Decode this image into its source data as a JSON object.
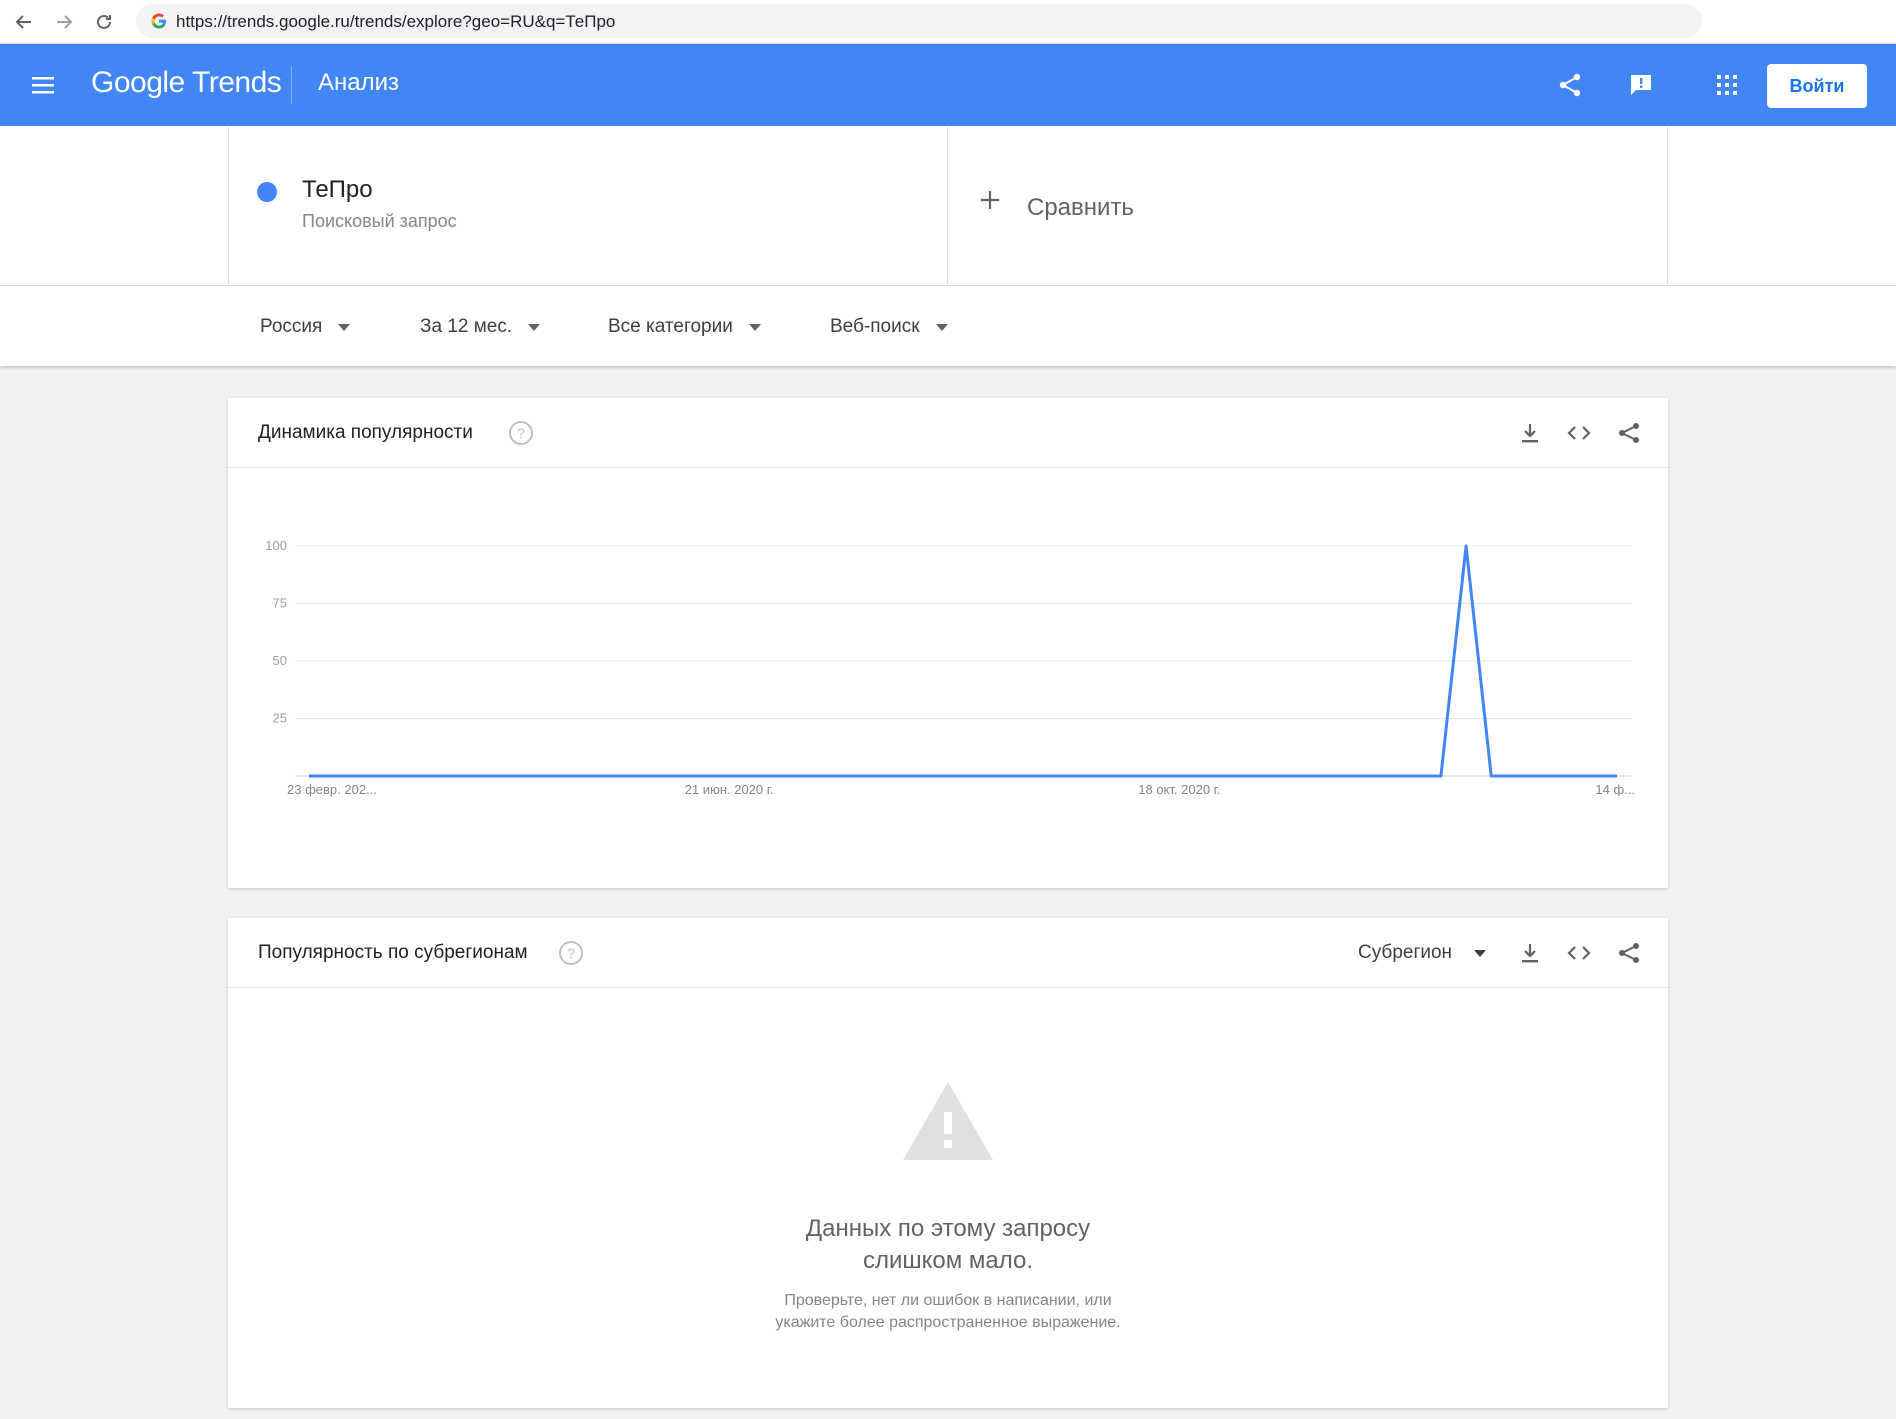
{
  "browser": {
    "url": "https://trends.google.ru/trends/explore?geo=RU&q=ТеПро"
  },
  "header": {
    "logo": "Google Trends",
    "title": "Анализ",
    "login_label": "Войти",
    "brand_color": "#4285f4"
  },
  "term": {
    "name": "ТеПро",
    "type": "Поисковый запрос",
    "color": "#4285f4"
  },
  "compare": {
    "label": "Сравнить"
  },
  "filters": {
    "region": "Россия",
    "period": "За 12 мес.",
    "category": "Все категории",
    "search_type": "Веб-поиск"
  },
  "interest_card": {
    "title": "Динамика популярности"
  },
  "subregion_card": {
    "title": "Популярность по субрегионам",
    "select_label": "Субрегион",
    "empty_title_line1": "Данных по этому запросу",
    "empty_title_line2": "слишком мало.",
    "empty_sub_line1": "Проверьте, нет ли ошибок в написании, или",
    "empty_sub_line2": "укажите более распространенное выражение."
  },
  "chart_data": {
    "type": "line",
    "ylim": [
      0,
      100
    ],
    "yticks": [
      25,
      50,
      75,
      100
    ],
    "xticks": [
      "23 февр. 202...",
      "21 июн. 2020 г.",
      "18 окт. 2020 г.",
      "14 ф..."
    ],
    "series": [
      {
        "color": "#4285f4",
        "x": [
          0,
          45,
          46,
          47,
          48,
          52
        ],
        "values": [
          0,
          0,
          100,
          0,
          0,
          0
        ]
      }
    ],
    "x_count": 53,
    "grid": true
  }
}
